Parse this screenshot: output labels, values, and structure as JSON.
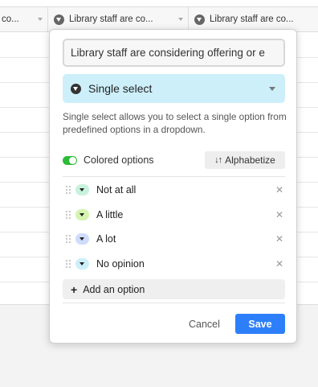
{
  "grid": {
    "columns": [
      {
        "label": "co..."
      },
      {
        "label": "Library staff are co..."
      },
      {
        "label": "Library staff are co..."
      }
    ]
  },
  "editor": {
    "field_name_value": "Library staff are considering offering or e",
    "field_type": {
      "label": "Single select",
      "icon": "single-select-icon",
      "accent_color": "#cdeffa"
    },
    "description": "Single select allows you to select a single option from predefined options in a dropdown.",
    "colored_options": {
      "label": "Colored options",
      "enabled": true,
      "toggle_color": "#2bbb39"
    },
    "alphabetize_label": "Alphabetize",
    "options": [
      {
        "label": "Not at all",
        "color": "#c9f2dc"
      },
      {
        "label": "A little",
        "color": "#d4f4b0"
      },
      {
        "label": "A lot",
        "color": "#cfdcfb"
      },
      {
        "label": "No opinion",
        "color": "#cdeffa"
      }
    ],
    "add_option_label": "Add an option",
    "cancel_label": "Cancel",
    "save_label": "Save",
    "save_color": "#2d7ff9"
  }
}
